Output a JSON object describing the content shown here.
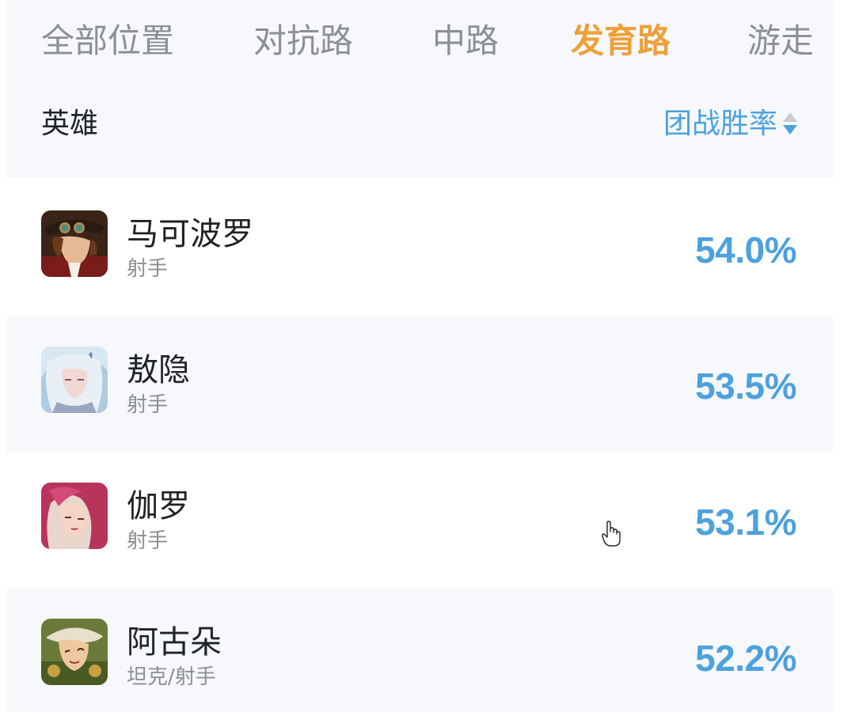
{
  "tabs": [
    {
      "label": "全部位置",
      "active": false
    },
    {
      "label": "对抗路",
      "active": false
    },
    {
      "label": "中路",
      "active": false
    },
    {
      "label": "发育路",
      "active": true
    },
    {
      "label": "游走",
      "active": false
    }
  ],
  "header": {
    "hero_col": "英雄",
    "sort_label": "团战胜率",
    "sort_icon": "sort-icon"
  },
  "heroes": [
    {
      "name": "马可波罗",
      "role": "射手",
      "rate": "54.0%",
      "avatar_icon": "hero-avatar-marco-polo"
    },
    {
      "name": "敖隐",
      "role": "射手",
      "rate": "53.5%",
      "avatar_icon": "hero-avatar-ao-yin"
    },
    {
      "name": "伽罗",
      "role": "射手",
      "rate": "53.1%",
      "avatar_icon": "hero-avatar-jia-luo"
    },
    {
      "name": "阿古朵",
      "role": "坦克/射手",
      "rate": "52.2%",
      "avatar_icon": "hero-avatar-a-gu-duo"
    }
  ],
  "colors": {
    "active_tab": "#eea038",
    "accent": "#4da1dd",
    "inactive_text": "#8c8f94",
    "row_alt_bg": "#f6f8fc"
  }
}
